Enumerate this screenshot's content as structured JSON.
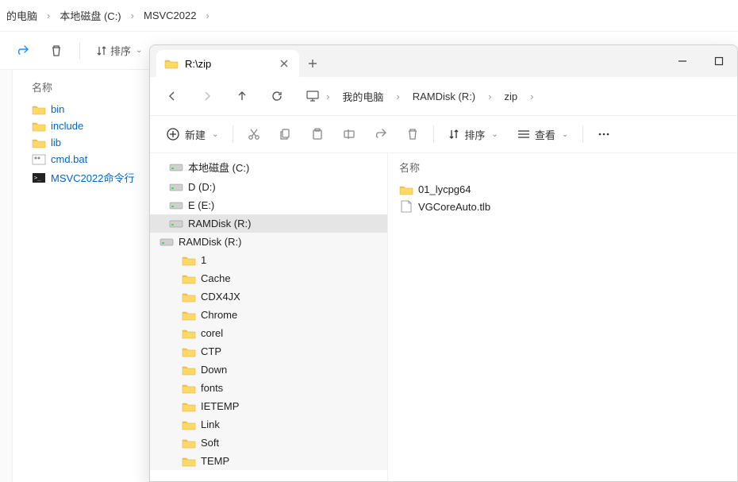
{
  "back_window": {
    "breadcrumb": [
      "的电脑",
      "本地磁盘 (C:)",
      "MSVC2022"
    ],
    "sort_label": "排序",
    "name_header": "名称",
    "items": [
      {
        "label": "bin",
        "icon": "folder"
      },
      {
        "label": "include",
        "icon": "folder"
      },
      {
        "label": "lib",
        "icon": "folder"
      },
      {
        "label": "cmd.bat",
        "icon": "bat"
      },
      {
        "label": "MSVC2022命令行",
        "icon": "console"
      }
    ]
  },
  "front_window": {
    "tab_title": "R:\\zip",
    "nav_crumbs": [
      "我的电脑",
      "RAMDisk (R:)",
      "zip"
    ],
    "new_button": "新建",
    "sort_label": "排序",
    "view_label": "查看",
    "tree": {
      "drives": [
        {
          "label": "本地磁盘 (C:)",
          "selected": false
        },
        {
          "label": "D (D:)",
          "selected": false
        },
        {
          "label": "E (E:)",
          "selected": false
        },
        {
          "label": "RAMDisk (R:)",
          "selected": true
        }
      ],
      "expanded_drive": "RAMDisk (R:)",
      "folders": [
        "1",
        "Cache",
        "CDX4JX",
        "Chrome",
        "corel",
        "CTP",
        "Down",
        "fonts",
        "IETEMP",
        "Link",
        "Soft",
        "TEMP"
      ]
    },
    "right_pane": {
      "name_header": "名称",
      "items": [
        {
          "label": "01_lycpg64",
          "icon": "folder"
        },
        {
          "label": "VGCoreAuto.tlb",
          "icon": "tlb"
        }
      ]
    }
  }
}
